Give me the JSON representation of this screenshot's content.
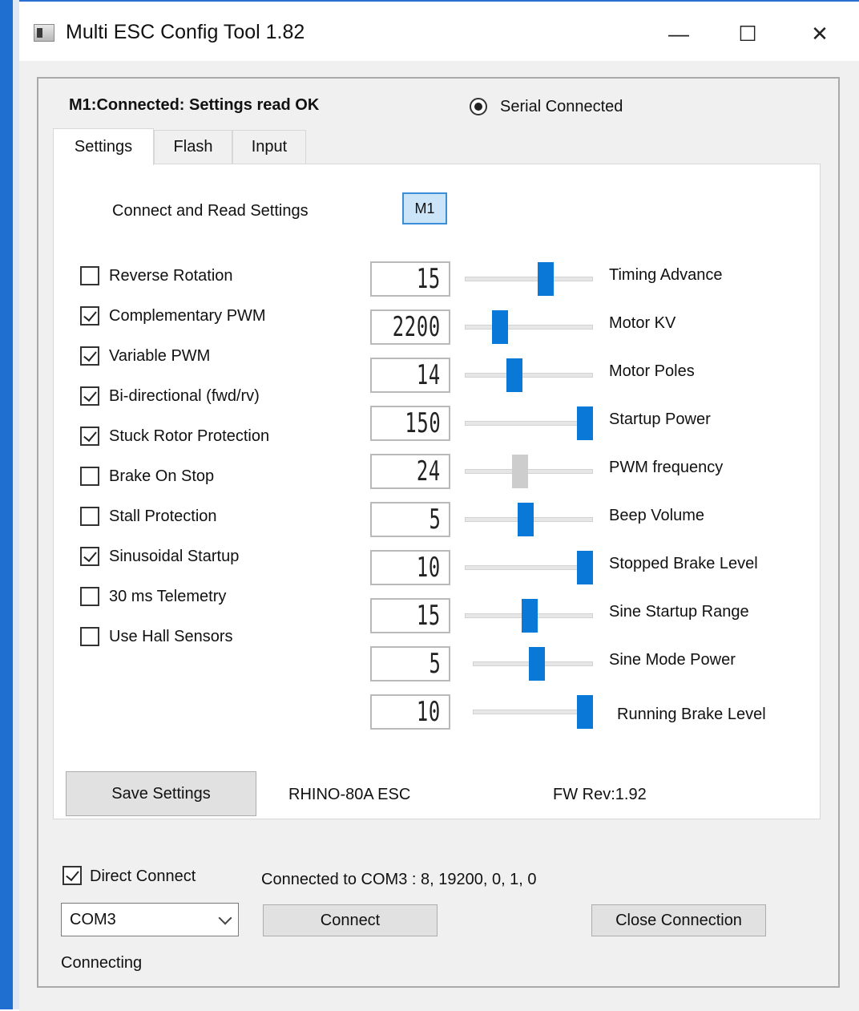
{
  "window": {
    "title": "Multi ESC Config Tool 1.82",
    "minimize": "—",
    "maximize": "☐",
    "close": "✕"
  },
  "status": {
    "main": "M1:Connected: Settings read OK",
    "serial_label": "Serial Connected",
    "serial_selected": true
  },
  "tabs": [
    "Settings",
    "Flash",
    "Input"
  ],
  "active_tab": "Settings",
  "settings": {
    "connect_read_label": "Connect and Read Settings",
    "m1_button": "M1",
    "checkboxes": [
      {
        "label": "Reverse Rotation",
        "checked": false
      },
      {
        "label": "Complementary PWM",
        "checked": true
      },
      {
        "label": "Variable PWM",
        "checked": true
      },
      {
        "label": "Bi-directional (fwd/rv)",
        "checked": true
      },
      {
        "label": "Stuck Rotor Protection",
        "checked": true
      },
      {
        "label": "Brake On Stop",
        "checked": false
      },
      {
        "label": "Stall Protection",
        "checked": false
      },
      {
        "label": "Sinusoidal Startup",
        "checked": true
      },
      {
        "label": "30 ms Telemetry",
        "checked": false
      },
      {
        "label": "Use Hall Sensors",
        "checked": false
      }
    ],
    "sliders": [
      {
        "value": "15",
        "label": "Timing Advance",
        "level": 0.65,
        "enabled": true
      },
      {
        "value": "2200",
        "label": "Motor KV",
        "level": 0.24,
        "enabled": true
      },
      {
        "value": "14",
        "label": "Motor Poles",
        "level": 0.37,
        "enabled": true
      },
      {
        "value": "150",
        "label": "Startup Power",
        "level": 1.0,
        "enabled": true
      },
      {
        "value": "24",
        "label": "PWM frequency",
        "level": 0.42,
        "enabled": false
      },
      {
        "value": "5",
        "label": "Beep Volume",
        "level": 0.47,
        "enabled": true
      },
      {
        "value": "10",
        "label": "Stopped Brake Level",
        "level": 1.0,
        "enabled": true
      },
      {
        "value": "15",
        "label": "Sine Startup Range",
        "level": 0.51,
        "enabled": true
      },
      {
        "value": "5",
        "label": "Sine Mode Power",
        "level": 0.54,
        "enabled": true
      },
      {
        "value": "10",
        "label": "Running Brake Level",
        "level": 1.0,
        "enabled": true
      }
    ],
    "save_button": "Save Settings",
    "esc_name": "RHINO-80A ESC",
    "fw_rev": "FW Rev:1.92"
  },
  "connection": {
    "direct_connect_label": "Direct Connect",
    "direct_connect_checked": true,
    "connected_text": "Connected to COM3 : 8, 19200, 0, 1, 0",
    "port": "COM3",
    "connect_button": "Connect",
    "close_button": "Close Connection",
    "status": "Connecting"
  },
  "colors": {
    "accent": "#0a78d7",
    "selected_button_bg": "#cce4f7",
    "window_border": "#1e6fd0"
  }
}
